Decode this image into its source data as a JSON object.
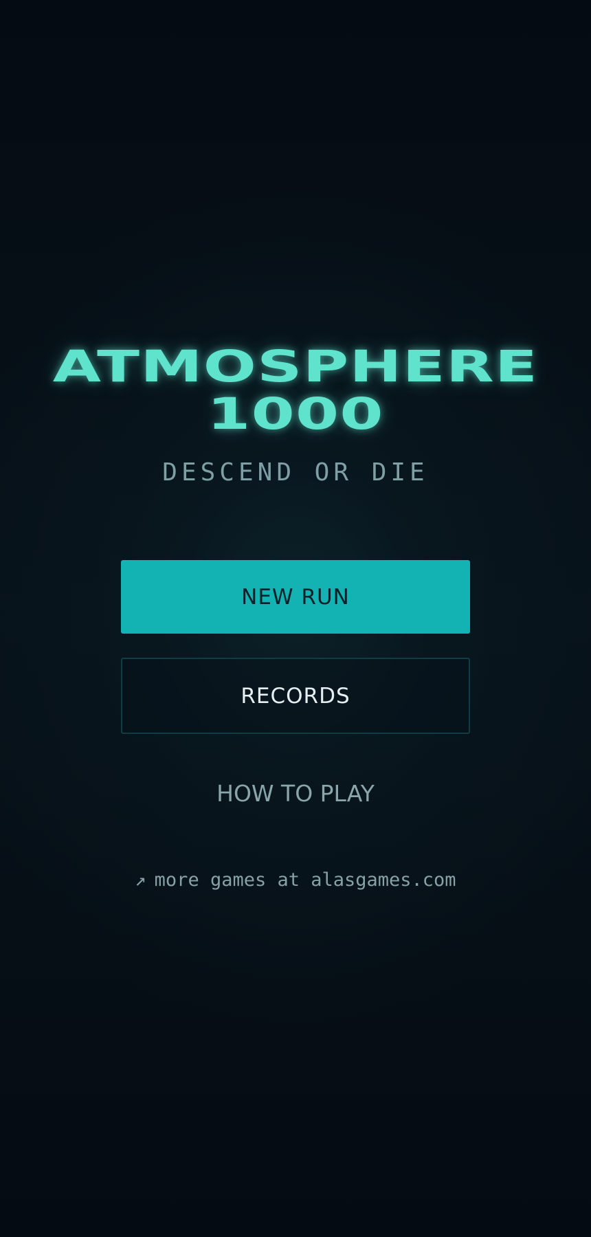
{
  "title": {
    "line1": "ATMOSPHERE",
    "line2": "1000"
  },
  "subtitle": "DESCEND OR DIE",
  "menu": {
    "new_run_label": "NEW RUN",
    "records_label": "RECORDS",
    "how_to_play_label": "HOW TO PLAY"
  },
  "footer": {
    "icon": "arrow-up-right-icon",
    "arrow_glyph": "↗",
    "text": "more games at alasgames.com"
  },
  "colors": {
    "accent": "#5fe3cc",
    "primary_button": "#13b3b4",
    "background": "#050b12"
  }
}
